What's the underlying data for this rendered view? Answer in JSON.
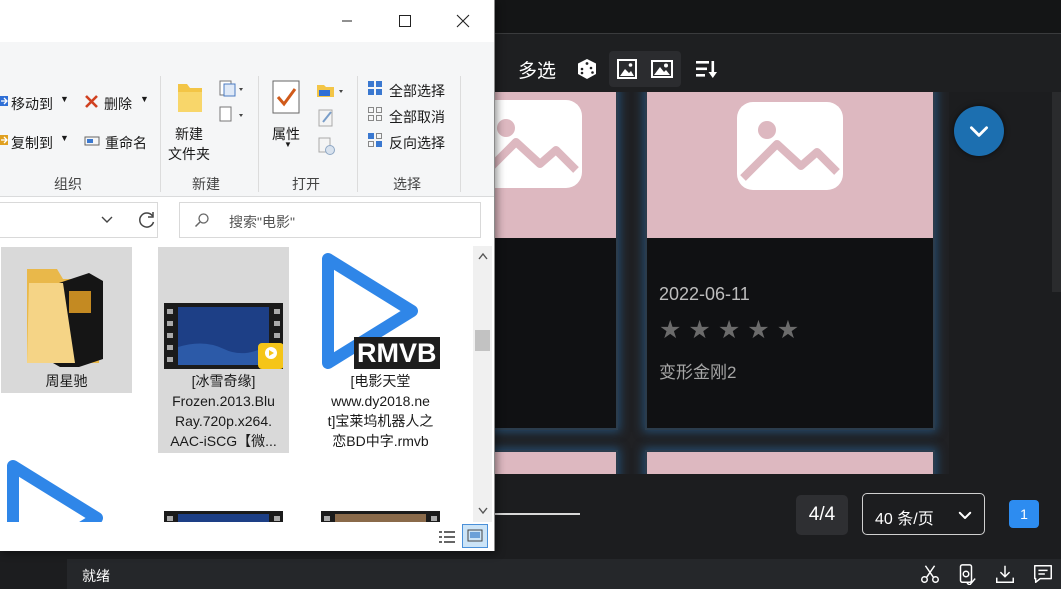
{
  "app": {
    "toolbar": {
      "multiselect_label": "多选",
      "icons": [
        "dice-icon",
        "image-outline-icon",
        "image-filled-icon",
        "sort-list-icon"
      ]
    },
    "cards": [
      {
        "date": "",
        "title": ""
      },
      {
        "date": "2022-06-11",
        "rating_stars": 5,
        "rating": 0,
        "title": "变形金刚2"
      }
    ],
    "pagination": {
      "page_count": "4/4",
      "page_size": "40 条/页",
      "current_page": "1"
    },
    "statusbar": {
      "text": "就绪",
      "icons": [
        "scissors-icon",
        "screenshot-icon",
        "download-icon",
        "message-icon"
      ]
    },
    "colors": {
      "accent": "#1c6fb0",
      "page_button": "#2d8cf0",
      "thumb_bg": "#ddb8c0"
    }
  },
  "explorer": {
    "ribbon": {
      "organize": {
        "move_to": "移动到",
        "delete": "删除",
        "copy_to": "复制到",
        "rename": "重命名",
        "group_label": "组织"
      },
      "new": {
        "new_folder_line1": "新建",
        "new_folder_line2": "文件夹",
        "group_label": "新建"
      },
      "open": {
        "properties": "属性",
        "group_label": "打开"
      },
      "select": {
        "select_all": "全部选择",
        "select_none": "全部取消",
        "invert": "反向选择",
        "group_label": "选择"
      }
    },
    "search": {
      "placeholder": "搜索\"电影\""
    },
    "files": [
      {
        "name_lines": [
          "周星驰"
        ],
        "type": "folder",
        "selected": true
      },
      {
        "name_lines": [
          "[冰雪奇缘]",
          "Frozen.2013.Blu",
          "Ray.720p.x264.",
          "AAC-iSCG【微..."
        ],
        "type": "video",
        "selected": true
      },
      {
        "name_lines": [
          "[电影天堂",
          "www.dy2018.ne",
          "t]宝莱坞机器人之",
          "恋BD中字.rmvb"
        ],
        "type": "rmvb",
        "badge": "RMVB",
        "selected": false
      }
    ]
  }
}
